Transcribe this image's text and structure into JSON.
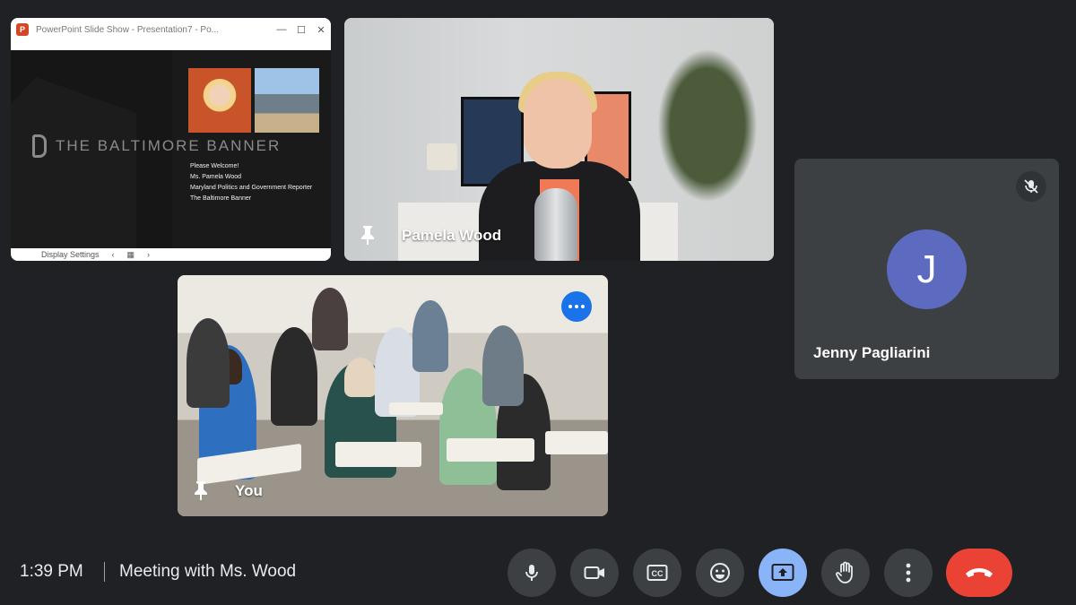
{
  "meeting": {
    "time": "1:39 PM",
    "title": "Meeting with Ms. Wood"
  },
  "presentation": {
    "window_title": "PowerPoint Slide Show  -  Presentation7 - Po...",
    "window_buttons": [
      "—",
      "☐",
      "✕"
    ],
    "slide_brand": "THE BALTIMORE BANNER",
    "slide_lines": [
      "Please Welcome!",
      "Ms. Pamela Wood",
      "Maryland Politics and Government Reporter",
      "The Baltimore Banner"
    ],
    "status_display_settings": "Display Settings"
  },
  "participants": {
    "pamela": {
      "name": "Pamela Wood"
    },
    "jenny": {
      "name": "Jenny Pagliarini",
      "initial": "J",
      "avatar_color": "#5c6bc0",
      "muted": true
    },
    "self": {
      "name": "You"
    }
  },
  "controls": [
    {
      "id": "mic",
      "icon": "microphone-icon"
    },
    {
      "id": "camera",
      "icon": "camera-icon"
    },
    {
      "id": "captions",
      "icon": "captions-icon",
      "text": "CC"
    },
    {
      "id": "reactions",
      "icon": "emoji-icon"
    },
    {
      "id": "present",
      "icon": "present-screen-icon",
      "active": true
    },
    {
      "id": "raise-hand",
      "icon": "raise-hand-icon"
    },
    {
      "id": "more",
      "icon": "more-vert-icon"
    },
    {
      "id": "leave",
      "icon": "end-call-icon"
    }
  ],
  "colors": {
    "background": "#202124",
    "tile": "#3c4043",
    "active_control": "#8ab4f8",
    "end_call": "#ea4335",
    "more_badge": "#1a73e8"
  }
}
